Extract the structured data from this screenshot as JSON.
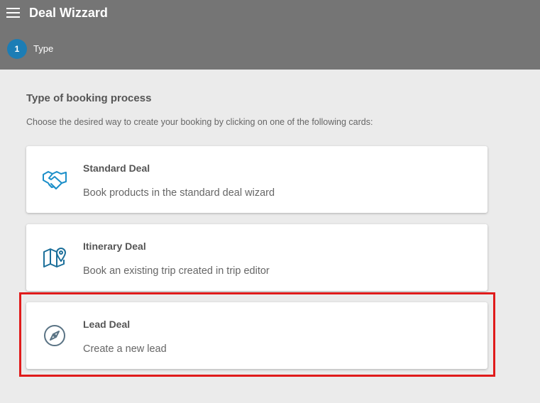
{
  "header": {
    "title": "Deal Wizzard",
    "menu_icon": "hamburger-menu-icon",
    "steps": [
      {
        "number": "1",
        "label": "Type",
        "color": "#1c7db5"
      }
    ],
    "background": "#757575"
  },
  "content": {
    "title": "Type of booking process",
    "description": "Choose the desired way to create your booking by clicking on one of the following cards:",
    "cards": [
      {
        "title": "Standard Deal",
        "description": "Book products in the standard deal wizard",
        "icon": "handshake-icon",
        "icon_color": "#1c8fc9"
      },
      {
        "title": "Itinerary Deal",
        "description": "Book an existing trip created in trip editor",
        "icon": "map-pin-icon",
        "icon_color": "#1c6f9a"
      },
      {
        "title": "Lead Deal",
        "description": "Create a new lead",
        "icon": "compass-icon",
        "icon_color": "#5a7384"
      }
    ]
  },
  "highlight": {
    "color": "#e01b1b",
    "target": "Lead Deal"
  }
}
